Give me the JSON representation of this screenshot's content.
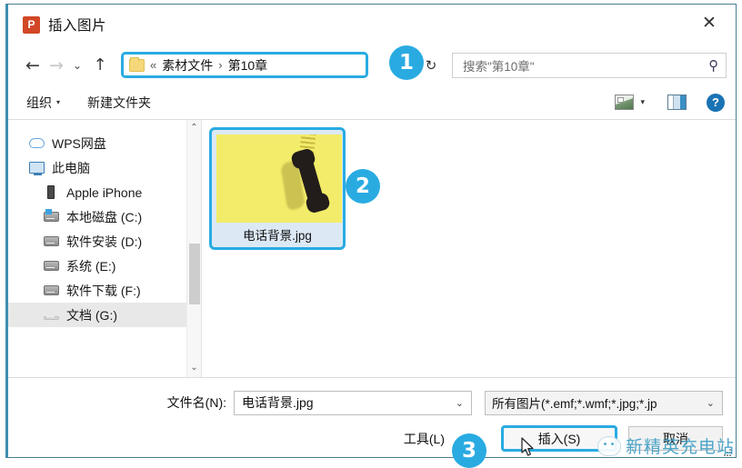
{
  "window": {
    "title": "插入图片",
    "app_icon": "powerpoint-icon",
    "close_label": "✕",
    "accent_color": "#29abe2",
    "frame_border_color": "#3d8fb0"
  },
  "address_bar": {
    "back_label": "←",
    "forward_label": "→",
    "history_label": "⌄",
    "up_label": "↑",
    "folder_icon": "folder-icon",
    "crumb_prefix": "«",
    "crumbs": [
      "素材文件",
      "第10章"
    ],
    "crumb_separator": "›",
    "dropdown_label": "⌄",
    "refresh_label": "↻"
  },
  "search": {
    "placeholder": "搜索\"第10章\"",
    "icon": "search-icon"
  },
  "toolbar": {
    "organize_label": "组织",
    "organize_caret": "▾",
    "new_folder_label": "新建文件夹",
    "view_icon": "view-layout-icon",
    "view_caret": "▾",
    "preview_pane_icon": "preview-pane-icon",
    "help_label": "?"
  },
  "nav_pane": {
    "items": [
      {
        "label": "WPS网盘",
        "icon": "cloud-icon",
        "indent": false,
        "selected": false
      },
      {
        "label": "此电脑",
        "icon": "computer-icon",
        "indent": false,
        "selected": false
      },
      {
        "label": "Apple iPhone",
        "icon": "phone-device-icon",
        "indent": true,
        "selected": false
      },
      {
        "label": "本地磁盘 (C:)",
        "icon": "drive-windows-icon",
        "indent": true,
        "selected": false
      },
      {
        "label": "软件安装 (D:)",
        "icon": "drive-icon",
        "indent": true,
        "selected": false
      },
      {
        "label": "系统 (E:)",
        "icon": "drive-icon",
        "indent": true,
        "selected": false
      },
      {
        "label": "软件下载 (F:)",
        "icon": "drive-icon",
        "indent": true,
        "selected": false
      },
      {
        "label": "文档 (G:)",
        "icon": "drive-icon",
        "indent": true,
        "selected": true
      }
    ],
    "scroll_up": "⌃",
    "scroll_down": "⌄"
  },
  "file_list": {
    "items": [
      {
        "name": "电话背景.jpg",
        "thumbnail": "yellow-background-telephone-handset",
        "selected": true
      }
    ]
  },
  "bottom": {
    "filename_label": "文件名(N):",
    "filename_value": "电话背景.jpg",
    "filename_caret": "⌄",
    "filetype_value": "所有图片(*.emf;*.wmf;*.jpg;*.jp",
    "filetype_caret": "⌄",
    "tools_label": "工具(L)",
    "insert_label": "插入(S)",
    "cancel_label": "取消"
  },
  "annotations": {
    "badges": [
      {
        "id": "1",
        "target": "address-bar"
      },
      {
        "id": "2",
        "target": "file-item"
      },
      {
        "id": "3",
        "target": "insert-button"
      }
    ],
    "cursor": "mouse-pointer"
  },
  "watermark": {
    "text": "新精英充电站",
    "logo": "wechat-logo",
    "color": "#3f9fc4"
  }
}
